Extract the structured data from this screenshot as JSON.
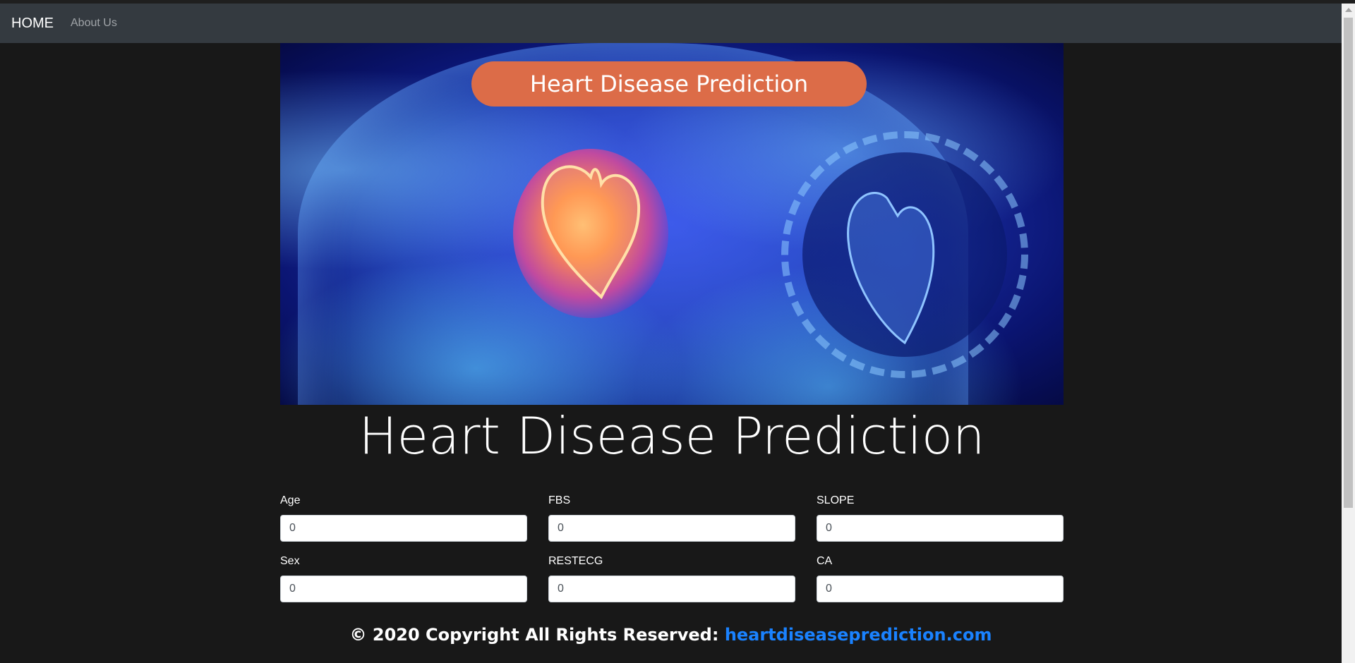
{
  "navbar": {
    "brand": "HOME",
    "links": [
      {
        "label": "About Us"
      }
    ]
  },
  "hero": {
    "banner_text": "Heart Disease Prediction"
  },
  "page": {
    "title": "Heart Disease Prediction"
  },
  "form": {
    "fields": [
      {
        "label": "Age",
        "value": "0"
      },
      {
        "label": "FBS",
        "value": "0"
      },
      {
        "label": "SLOPE",
        "value": "0"
      },
      {
        "label": "Sex",
        "value": "0"
      },
      {
        "label": "RESTECG",
        "value": "0"
      },
      {
        "label": "CA",
        "value": "0"
      }
    ]
  },
  "footer": {
    "text": "© 2020 Copyright All Rights Reserved: ",
    "link_text": "heartdiseaseprediction.com"
  },
  "colors": {
    "navbar_bg": "#343a40",
    "page_bg": "#181818",
    "banner": "#dc6c48",
    "footer_link": "#1a82ff"
  }
}
